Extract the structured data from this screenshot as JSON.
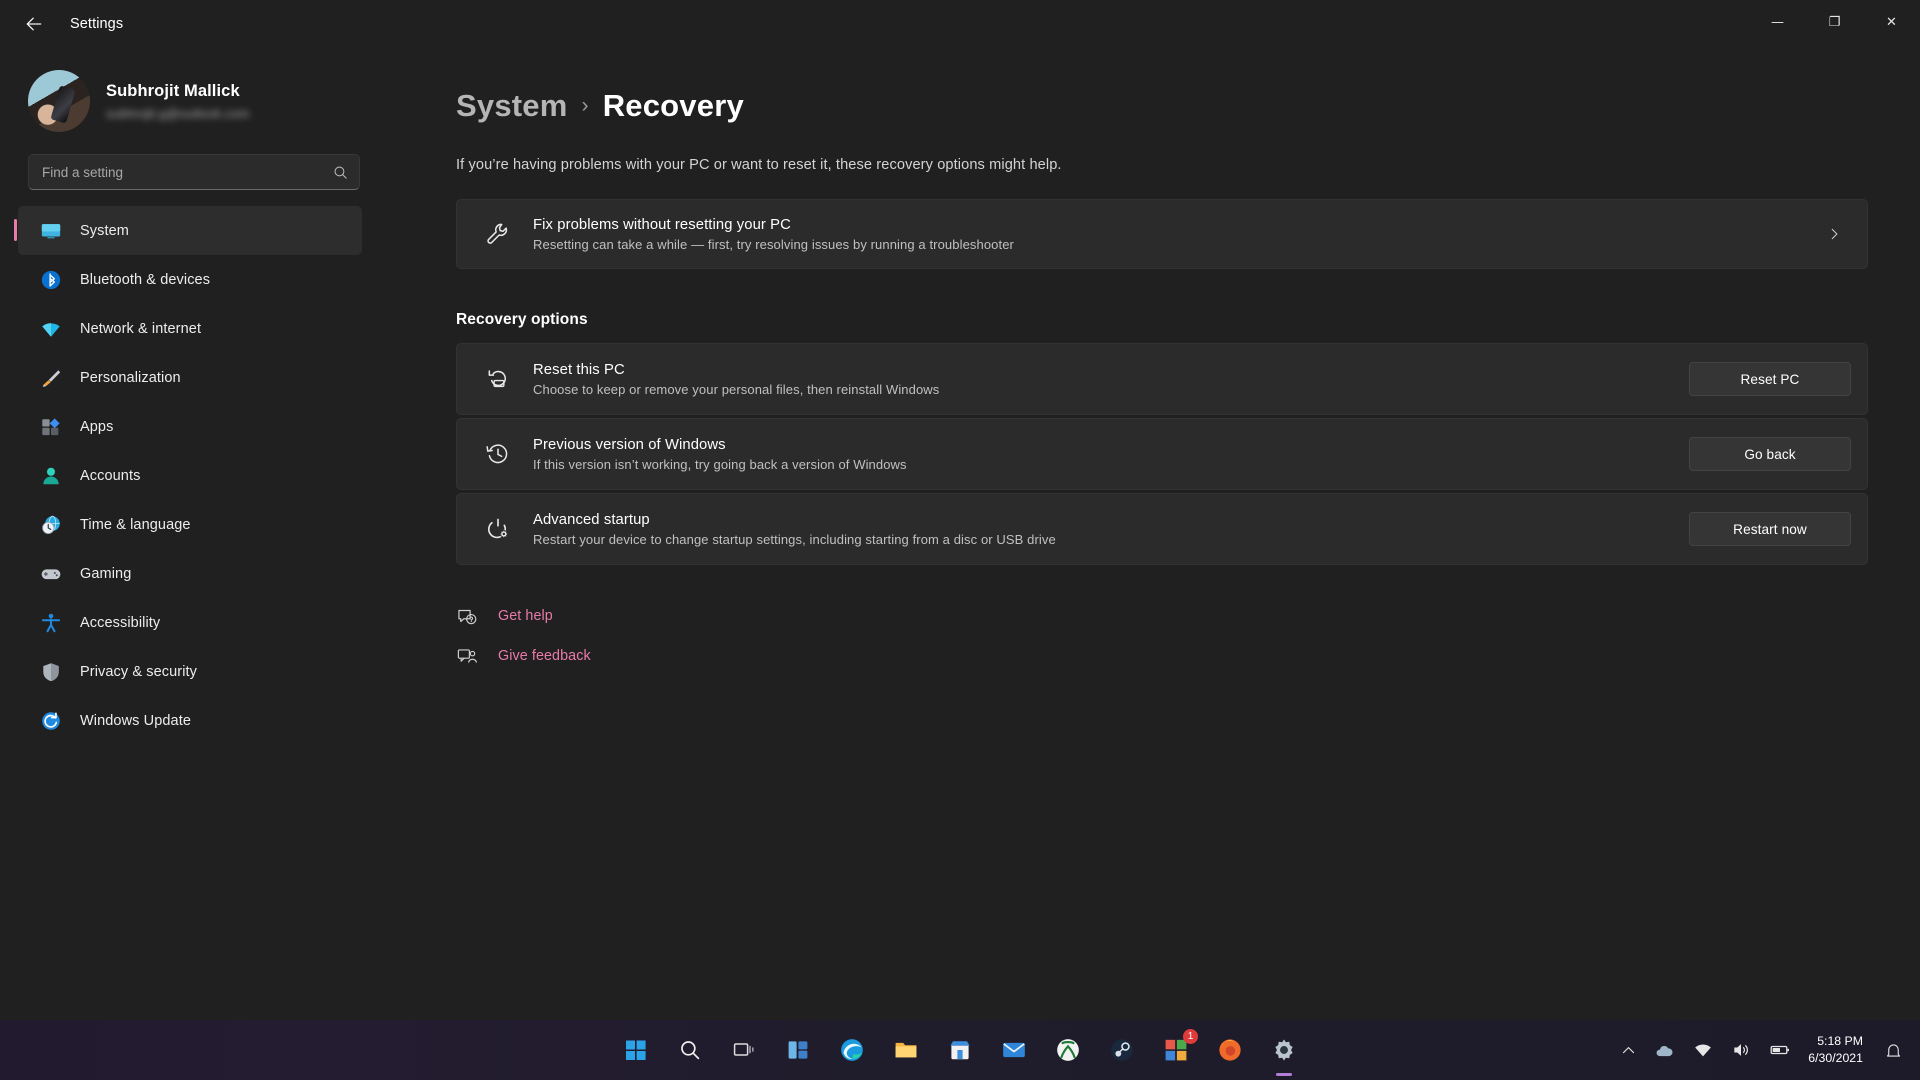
{
  "window": {
    "title": "Settings",
    "back_icon": "back-arrow-icon",
    "minimize_label": "—",
    "maximize_label": "❐",
    "close_label": "✕"
  },
  "profile": {
    "name": "Subhrojit Mallick",
    "email": "subhrojit.g@outlook.com"
  },
  "search": {
    "placeholder": "Find a setting",
    "value": ""
  },
  "sidebar": {
    "items": [
      {
        "label": "System",
        "icon": "monitor-icon",
        "active": true
      },
      {
        "label": "Bluetooth & devices",
        "icon": "bluetooth-icon",
        "active": false
      },
      {
        "label": "Network & internet",
        "icon": "wifi-icon",
        "active": false
      },
      {
        "label": "Personalization",
        "icon": "paintbrush-icon",
        "active": false
      },
      {
        "label": "Apps",
        "icon": "apps-icon",
        "active": false
      },
      {
        "label": "Accounts",
        "icon": "person-icon",
        "active": false
      },
      {
        "label": "Time & language",
        "icon": "clock-globe-icon",
        "active": false
      },
      {
        "label": "Gaming",
        "icon": "gamepad-icon",
        "active": false
      },
      {
        "label": "Accessibility",
        "icon": "accessibility-icon",
        "active": false
      },
      {
        "label": "Privacy & security",
        "icon": "shield-icon",
        "active": false
      },
      {
        "label": "Windows Update",
        "icon": "update-icon",
        "active": false
      }
    ]
  },
  "main": {
    "breadcrumb_parent": "System",
    "breadcrumb_separator": "›",
    "breadcrumb_current": "Recovery",
    "intro": "If you’re having problems with your PC or want to reset it, these recovery options might help.",
    "troubleshoot_card": {
      "icon": "wrench-icon",
      "title": "Fix problems without resetting your PC",
      "subtitle": "Resetting can take a while — first, try resolving issues by running a troubleshooter",
      "chevron": "chevron-right-icon"
    },
    "section_title": "Recovery options",
    "options": [
      {
        "icon": "reset-pc-icon",
        "title": "Reset this PC",
        "subtitle": "Choose to keep or remove your personal files, then reinstall Windows",
        "button": "Reset PC"
      },
      {
        "icon": "history-clock-icon",
        "title": "Previous version of Windows",
        "subtitle": "If this version isn’t working, try going back a version of Windows",
        "button": "Go back"
      },
      {
        "icon": "power-gear-icon",
        "title": "Advanced startup",
        "subtitle": "Restart your device to change startup settings, including starting from a disc or USB drive",
        "button": "Restart now"
      }
    ],
    "links": [
      {
        "label": "Get help",
        "icon": "help-question-icon"
      },
      {
        "label": "Give feedback",
        "icon": "feedback-person-icon"
      }
    ],
    "link_color": "#e87ba9"
  },
  "taskbar": {
    "buttons": [
      {
        "name": "start",
        "icon": "windows-start-icon",
        "badge": ""
      },
      {
        "name": "search",
        "icon": "search-icon",
        "badge": ""
      },
      {
        "name": "task-view",
        "icon": "task-view-icon",
        "badge": ""
      },
      {
        "name": "widgets",
        "icon": "widgets-icon",
        "badge": ""
      },
      {
        "name": "edge",
        "icon": "edge-browser-icon",
        "badge": ""
      },
      {
        "name": "file-explorer",
        "icon": "file-explorer-icon",
        "badge": ""
      },
      {
        "name": "microsoft-store",
        "icon": "store-icon",
        "badge": ""
      },
      {
        "name": "mail",
        "icon": "mail-icon",
        "badge": ""
      },
      {
        "name": "xbox",
        "icon": "xbox-icon",
        "badge": ""
      },
      {
        "name": "steam",
        "icon": "steam-icon",
        "badge": ""
      },
      {
        "name": "office",
        "icon": "office-icon",
        "badge": "1"
      },
      {
        "name": "firefox",
        "icon": "firefox-icon",
        "badge": ""
      },
      {
        "name": "settings",
        "icon": "settings-gear-icon",
        "badge": ""
      }
    ],
    "tray": {
      "chevron": "chevron-up-icon",
      "cloud": "onedrive-cloud-icon",
      "wifi": "wifi-tray-icon",
      "volume": "volume-icon",
      "battery": "battery-icon",
      "notifications": "notification-bell-icon",
      "time": "5:18 PM",
      "date": "6/30/2021"
    }
  }
}
